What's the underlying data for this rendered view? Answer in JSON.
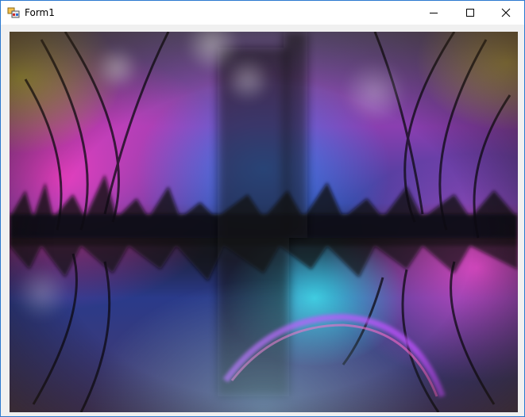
{
  "window": {
    "title": "Form1",
    "accent_border": "#2b79d0",
    "controls": {
      "minimize_icon": "minimize-icon",
      "maximize_icon": "maximize-icon",
      "close_icon": "close-icon"
    }
  },
  "picture_box": {
    "content": "fisheye-forest-lake-image"
  }
}
